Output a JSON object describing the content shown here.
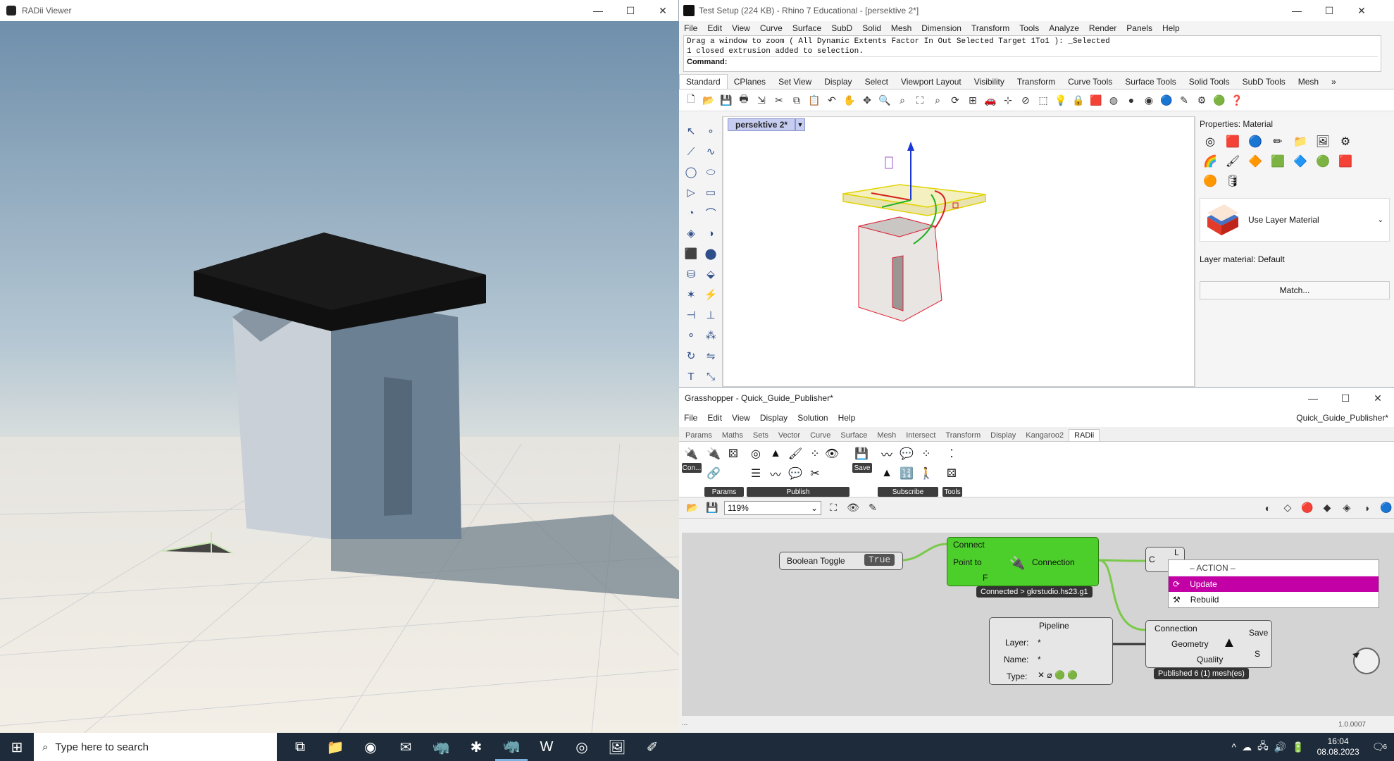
{
  "radii": {
    "title": "RADii Viewer",
    "controls": [
      "—",
      "☐",
      "✕"
    ]
  },
  "rhino": {
    "title": "Test Setup (224 KB) - Rhino 7 Educational - [persektive 2*]",
    "controls": [
      "—",
      "☐",
      "✕"
    ],
    "menu": [
      "File",
      "Edit",
      "View",
      "Curve",
      "Surface",
      "SubD",
      "Solid",
      "Mesh",
      "Dimension",
      "Transform",
      "Tools",
      "Analyze",
      "Render",
      "Panels",
      "Help"
    ],
    "command_history": [
      "Drag a window to zoom ( All  Dynamic  Extents  Factor  In  Out  Selected  Target  1To1 ): _Selected",
      "1 closed extrusion added to selection."
    ],
    "command_prompt": "Command:",
    "toolbar_tabs": [
      "Standard",
      "CPlanes",
      "Set View",
      "Display",
      "Select",
      "Viewport Layout",
      "Visibility",
      "Transform",
      "Curve Tools",
      "Surface Tools",
      "Solid Tools",
      "SubD Tools",
      "Mesh"
    ],
    "toolbar_more": "»",
    "viewport_tab": "persektive 2*",
    "properties": {
      "header": "Properties: Material",
      "material": "Use Layer Material",
      "layer_material": "Layer material: Default",
      "match_button": "Match..."
    }
  },
  "grasshopper": {
    "title": "Grasshopper - Quick_Guide_Publisher*",
    "controls": [
      "—",
      "☐",
      "✕"
    ],
    "menu": [
      "File",
      "Edit",
      "View",
      "Display",
      "Solution",
      "Help"
    ],
    "doc_name": "Quick_Guide_Publisher*",
    "tabs": [
      "Params",
      "Maths",
      "Sets",
      "Vector",
      "Curve",
      "Surface",
      "Mesh",
      "Intersect",
      "Transform",
      "Display",
      "Kangaroo2",
      "RADii"
    ],
    "ribbon_groups": {
      "con": "Con...",
      "params": "Params",
      "publish": "Publish",
      "save": "Save",
      "subscribe": "Subscribe",
      "tools": "Tools"
    },
    "zoom": "119%",
    "nodes": {
      "boolean_toggle": {
        "label": "Boolean Toggle",
        "value": "True"
      },
      "connect": {
        "title": "Connect",
        "input_label": "Point to",
        "output_label": "Connection",
        "f": "F",
        "message": "Connected > gkrstudio.hs23.g1"
      },
      "small_node": {
        "c": "C",
        "l": "L"
      },
      "pipeline": {
        "title": "Pipeline",
        "layer": "Layer:",
        "layer_val": "*",
        "name": "Name:",
        "name_val": "*",
        "type": "Type:"
      },
      "publisher": {
        "in1": "Connection",
        "in2": "Geometry",
        "in3": "Quality",
        "out1": "Save",
        "out2": "S",
        "message": "Published 6 (1) mesh(es)"
      }
    },
    "context_menu": {
      "header": "– ACTION –",
      "items": [
        "Update",
        "Rebuild"
      ]
    },
    "version": "1.0.0007",
    "status_dots": "..."
  },
  "taskbar": {
    "search_placeholder": "Type here to search",
    "time": "16:04",
    "date": "08.08.2023",
    "notification_count": "6"
  },
  "colors": {
    "gh_green": "#4ccf2a",
    "highlight": "#c300a6",
    "viewport_tab": "#c6cdf0",
    "taskbar": "#1d2b3a"
  }
}
